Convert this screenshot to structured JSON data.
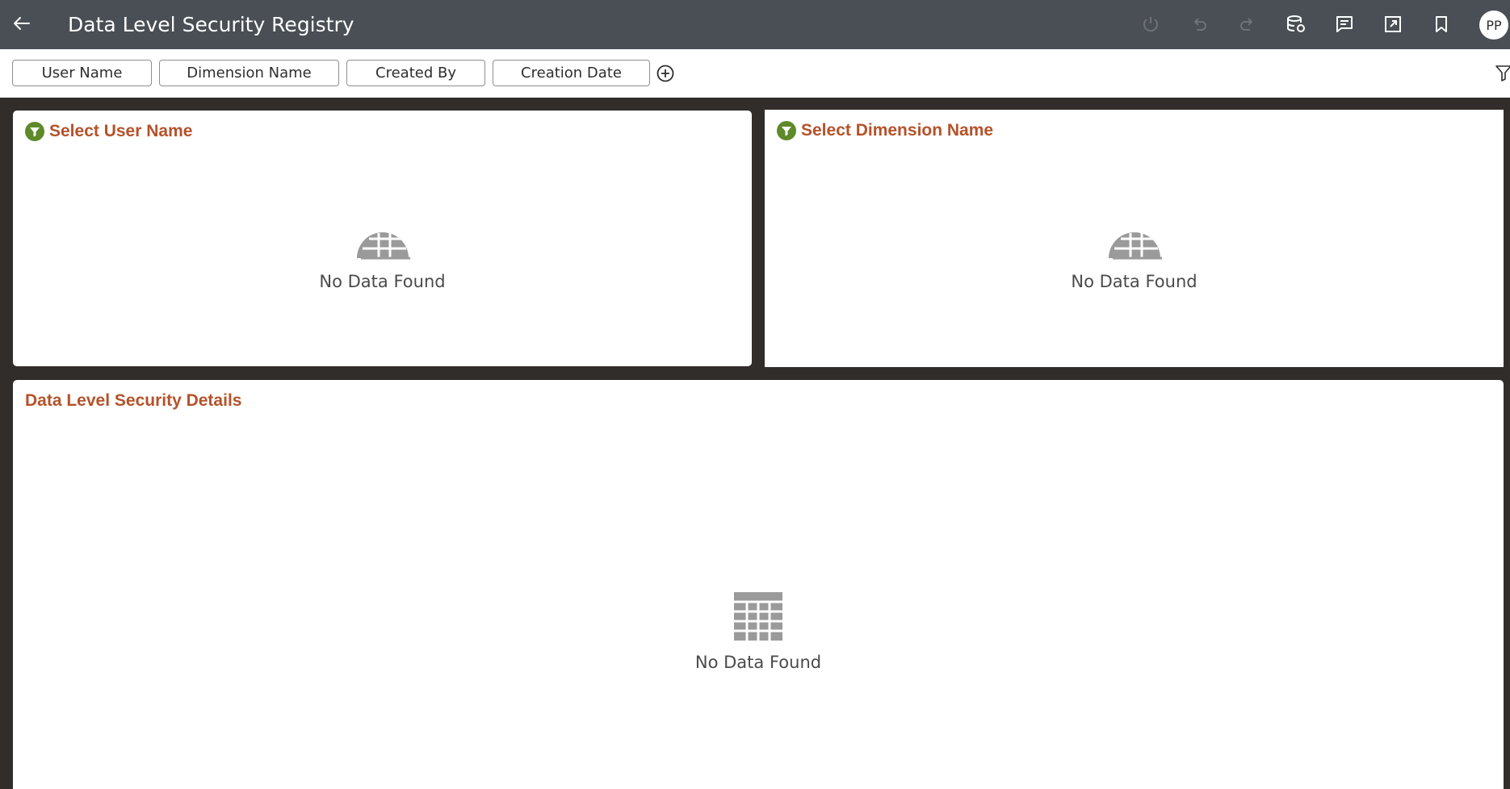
{
  "header": {
    "title": "Data Level Security Registry",
    "avatar_initials": "PP"
  },
  "filters": {
    "chips": [
      "User Name",
      "Dimension Name",
      "Created By",
      "Creation Date"
    ]
  },
  "panels": {
    "user": {
      "title": "Select User Name",
      "empty_text": "No Data Found"
    },
    "dimension": {
      "title": "Select Dimension Name",
      "empty_text": "No Data Found"
    },
    "details": {
      "title": "Data Level Security Details",
      "empty_text": "No Data Found"
    }
  },
  "colors": {
    "header_bg": "#4a4e55",
    "page_bg": "#312d2a",
    "panel_title": "#b5522a",
    "filter_icon": "#5f8a2a",
    "empty_icon": "#9a9a9a"
  }
}
